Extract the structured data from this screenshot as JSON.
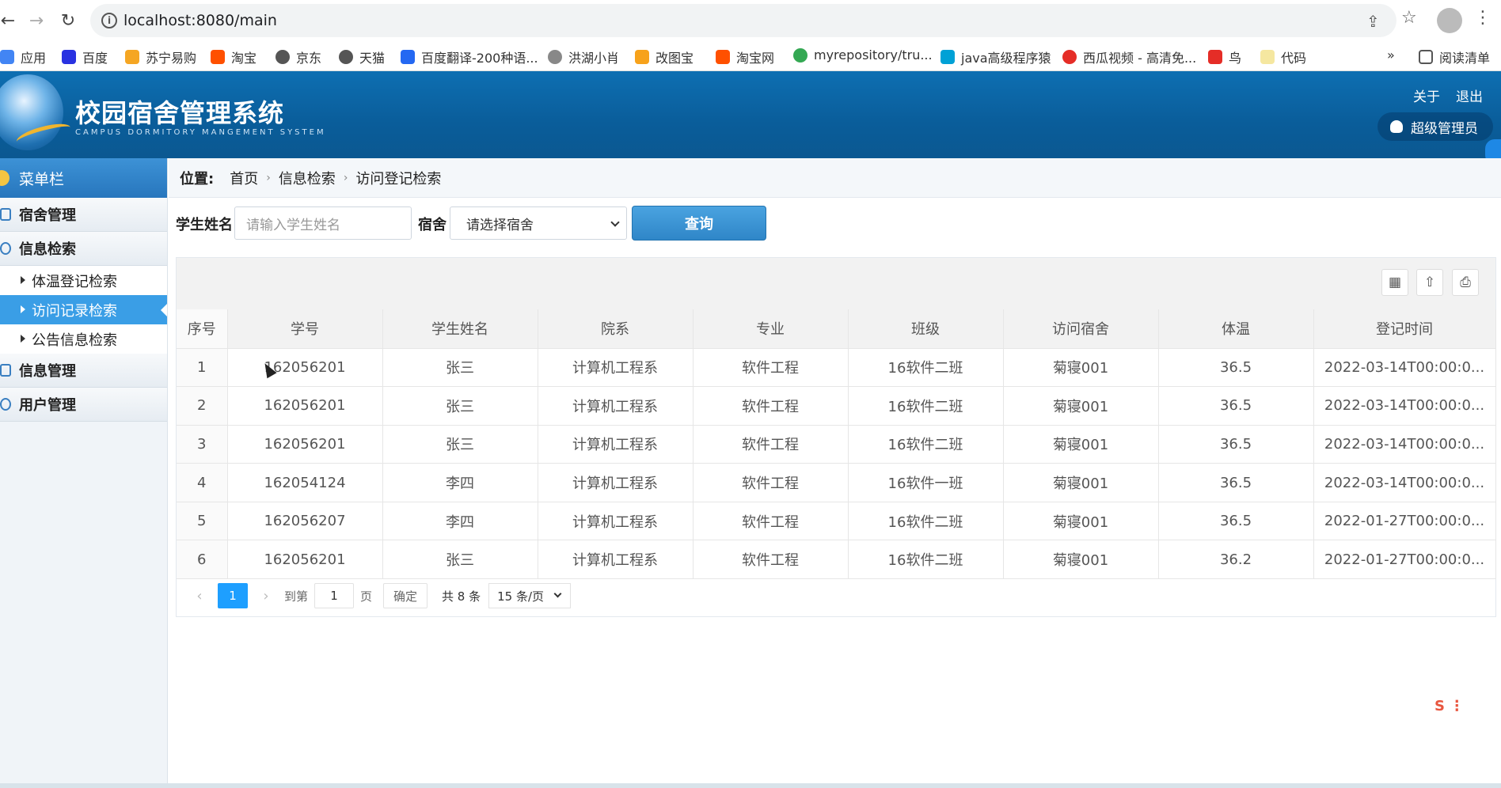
{
  "browser": {
    "url": "localhost:8080/main",
    "bookmarks": [
      "应用",
      "百度",
      "苏宁易购",
      "淘宝",
      "京东",
      "天猫",
      "百度翻译-200种语...",
      "洪湖小肖",
      "改图宝",
      "淘宝网",
      "myrepository/tru...",
      "java高级程序猿",
      "西瓜视频 - 高清免...",
      "鸟",
      "代码"
    ],
    "more_label": "»",
    "reading_list": "阅读清单"
  },
  "header": {
    "title": "校园宿舍管理系统",
    "subtitle": "CAMPUS DORMITORY MANGEMENT SYSTEM",
    "about": "关于",
    "logout": "退出",
    "user": "超级管理员"
  },
  "sidebar": {
    "title": "菜单栏",
    "groups": [
      {
        "label": "宿舍管理"
      },
      {
        "label": "信息检索"
      },
      {
        "label": "信息管理"
      },
      {
        "label": "用户管理"
      }
    ],
    "items": [
      {
        "label": "体温登记检索"
      },
      {
        "label": "访问记录检索"
      },
      {
        "label": "公告信息检索"
      }
    ]
  },
  "breadcrumb": {
    "label": "位置:",
    "items": [
      "首页",
      "信息检索",
      "访问登记检索"
    ]
  },
  "search": {
    "name_label": "学生姓名",
    "name_placeholder": "请输入学生姓名",
    "dorm_label": "宿舍",
    "dorm_value": "请选择宿舍",
    "button": "查询"
  },
  "table": {
    "columns": [
      "序号",
      "学号",
      "学生姓名",
      "院系",
      "专业",
      "班级",
      "访问宿舍",
      "体温",
      "登记时间"
    ],
    "rows": [
      [
        "1",
        "162056201",
        "张三",
        "计算机工程系",
        "软件工程",
        "16软件二班",
        "菊寝001",
        "36.5",
        "2022-03-14T00:00:0..."
      ],
      [
        "2",
        "162056201",
        "张三",
        "计算机工程系",
        "软件工程",
        "16软件二班",
        "菊寝001",
        "36.5",
        "2022-03-14T00:00:0..."
      ],
      [
        "3",
        "162056201",
        "张三",
        "计算机工程系",
        "软件工程",
        "16软件二班",
        "菊寝001",
        "36.5",
        "2022-03-14T00:00:0..."
      ],
      [
        "4",
        "162054124",
        "李四",
        "计算机工程系",
        "软件工程",
        "16软件一班",
        "菊寝001",
        "36.5",
        "2022-03-14T00:00:0..."
      ],
      [
        "5",
        "162056207",
        "李四",
        "计算机工程系",
        "软件工程",
        "16软件二班",
        "菊寝001",
        "36.5",
        "2022-01-27T00:00:0..."
      ],
      [
        "6",
        "162056201",
        "张三",
        "计算机工程系",
        "软件工程",
        "16软件二班",
        "菊寝001",
        "36.2",
        "2022-01-27T00:00:0..."
      ]
    ]
  },
  "pager": {
    "current": "1",
    "goto_label": "到第",
    "goto_value": "1",
    "page_label": "页",
    "confirm": "确定",
    "total": "共 8 条",
    "per_page": "15 条/页"
  },
  "colors": {
    "header_blue": "#0e6fb2",
    "active_item": "#3a9ee6",
    "pager_current": "#1e9fff"
  }
}
